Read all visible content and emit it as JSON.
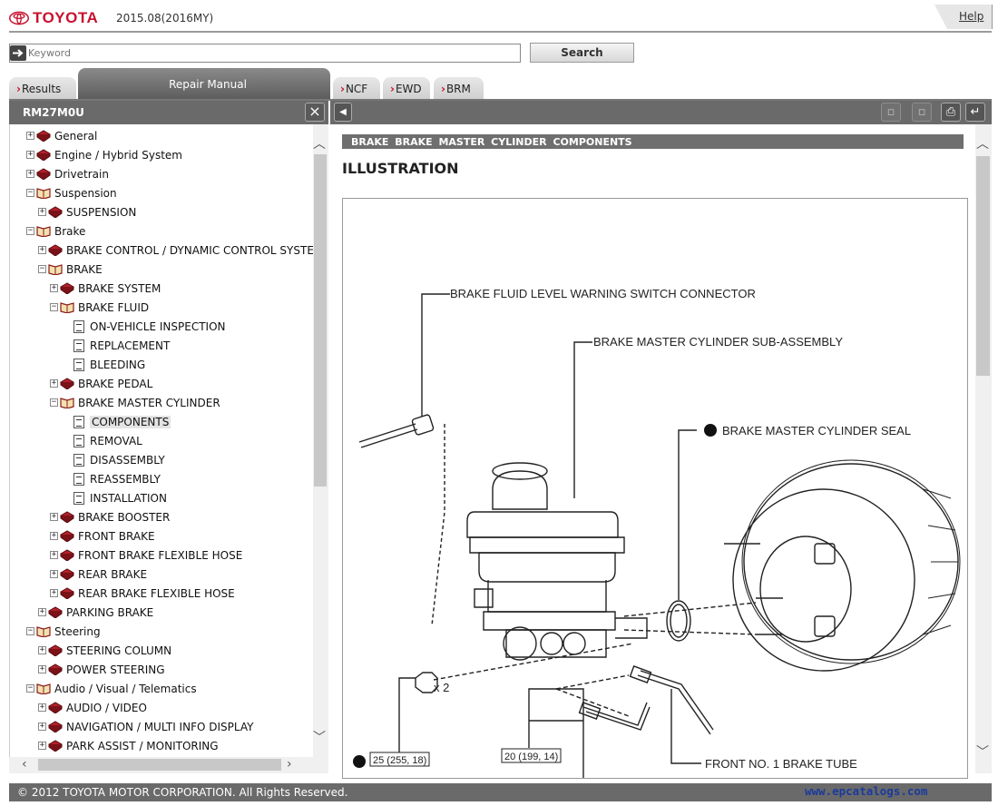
{
  "header": {
    "brand": "TOYOTA",
    "model_year": "2015.08(2016MY)",
    "help_label": "Help"
  },
  "search": {
    "placeholder": "Keyword",
    "button_label": "Search"
  },
  "tabs": {
    "results": "Results",
    "repair_manual": "Repair Manual",
    "ncf": "NCF",
    "ewd": "EWD",
    "brm": "BRM"
  },
  "left_panel": {
    "title": "RM27M0U",
    "tree": [
      {
        "label": "General",
        "level": 0,
        "icon": "book",
        "state": "collapsed"
      },
      {
        "label": "Engine / Hybrid System",
        "level": 0,
        "icon": "book",
        "state": "collapsed"
      },
      {
        "label": "Drivetrain",
        "level": 0,
        "icon": "book",
        "state": "collapsed"
      },
      {
        "label": "Suspension",
        "level": 0,
        "icon": "open-book",
        "state": "expanded"
      },
      {
        "label": "SUSPENSION",
        "level": 1,
        "icon": "book",
        "state": "collapsed"
      },
      {
        "label": "Brake",
        "level": 0,
        "icon": "open-book",
        "state": "expanded"
      },
      {
        "label": "BRAKE CONTROL / DYNAMIC CONTROL SYSTEMS",
        "level": 1,
        "icon": "book",
        "state": "collapsed"
      },
      {
        "label": "BRAKE",
        "level": 1,
        "icon": "open-book",
        "state": "expanded"
      },
      {
        "label": "BRAKE SYSTEM",
        "level": 2,
        "icon": "book",
        "state": "collapsed"
      },
      {
        "label": "BRAKE FLUID",
        "level": 2,
        "icon": "open-book",
        "state": "expanded"
      },
      {
        "label": "ON-VEHICLE INSPECTION",
        "level": 3,
        "icon": "page",
        "state": "leaf"
      },
      {
        "label": "REPLACEMENT",
        "level": 3,
        "icon": "page",
        "state": "leaf"
      },
      {
        "label": "BLEEDING",
        "level": 3,
        "icon": "page",
        "state": "leaf"
      },
      {
        "label": "BRAKE PEDAL",
        "level": 2,
        "icon": "book",
        "state": "collapsed"
      },
      {
        "label": "BRAKE MASTER CYLINDER",
        "level": 2,
        "icon": "open-book",
        "state": "expanded"
      },
      {
        "label": "COMPONENTS",
        "level": 3,
        "icon": "page",
        "state": "leaf",
        "selected": true
      },
      {
        "label": "REMOVAL",
        "level": 3,
        "icon": "page",
        "state": "leaf"
      },
      {
        "label": "DISASSEMBLY",
        "level": 3,
        "icon": "page",
        "state": "leaf"
      },
      {
        "label": "REASSEMBLY",
        "level": 3,
        "icon": "page",
        "state": "leaf"
      },
      {
        "label": "INSTALLATION",
        "level": 3,
        "icon": "page",
        "state": "leaf"
      },
      {
        "label": "BRAKE BOOSTER",
        "level": 2,
        "icon": "book",
        "state": "collapsed"
      },
      {
        "label": "FRONT BRAKE",
        "level": 2,
        "icon": "book",
        "state": "collapsed"
      },
      {
        "label": "FRONT BRAKE FLEXIBLE HOSE",
        "level": 2,
        "icon": "book",
        "state": "collapsed"
      },
      {
        "label": "REAR BRAKE",
        "level": 2,
        "icon": "book",
        "state": "collapsed"
      },
      {
        "label": "REAR BRAKE FLEXIBLE HOSE",
        "level": 2,
        "icon": "book",
        "state": "collapsed"
      },
      {
        "label": "PARKING BRAKE",
        "level": 1,
        "icon": "book",
        "state": "collapsed"
      },
      {
        "label": "Steering",
        "level": 0,
        "icon": "open-book",
        "state": "expanded"
      },
      {
        "label": "STEERING COLUMN",
        "level": 1,
        "icon": "book",
        "state": "collapsed"
      },
      {
        "label": "POWER STEERING",
        "level": 1,
        "icon": "book",
        "state": "collapsed"
      },
      {
        "label": "Audio / Visual / Telematics",
        "level": 0,
        "icon": "open-book",
        "state": "expanded"
      },
      {
        "label": "AUDIO / VIDEO",
        "level": 1,
        "icon": "book",
        "state": "collapsed"
      },
      {
        "label": "NAVIGATION / MULTI INFO DISPLAY",
        "level": 1,
        "icon": "book",
        "state": "collapsed"
      },
      {
        "label": "PARK ASSIST / MONITORING",
        "level": 1,
        "icon": "book",
        "state": "collapsed"
      }
    ]
  },
  "document": {
    "breadcrumb": "BRAKE  BRAKE MASTER CYLINDER  COMPONENTS",
    "heading": "ILLUSTRATION",
    "callouts": {
      "connector": "BRAKE FLUID LEVEL WARNING SWITCH CONNECTOR",
      "subassembly": "BRAKE MASTER CYLINDER SUB-ASSEMBLY",
      "seal": "BRAKE MASTER CYLINDER SEAL",
      "nut_qty": "x 2",
      "torque1": "25 (255, 18)",
      "torque2": "20 (199, 14)",
      "front_tube": "FRONT NO. 1 BRAKE TUBE"
    }
  },
  "footer": {
    "copyright": "© 2012 TOYOTA MOTOR CORPORATION. All Rights Reserved.",
    "watermark": "www.epcatalogs.com"
  },
  "colors": {
    "brand_red": "#c8102e",
    "bar_gray": "#6a6a6a",
    "watermark_blue": "#1a3a9c"
  }
}
